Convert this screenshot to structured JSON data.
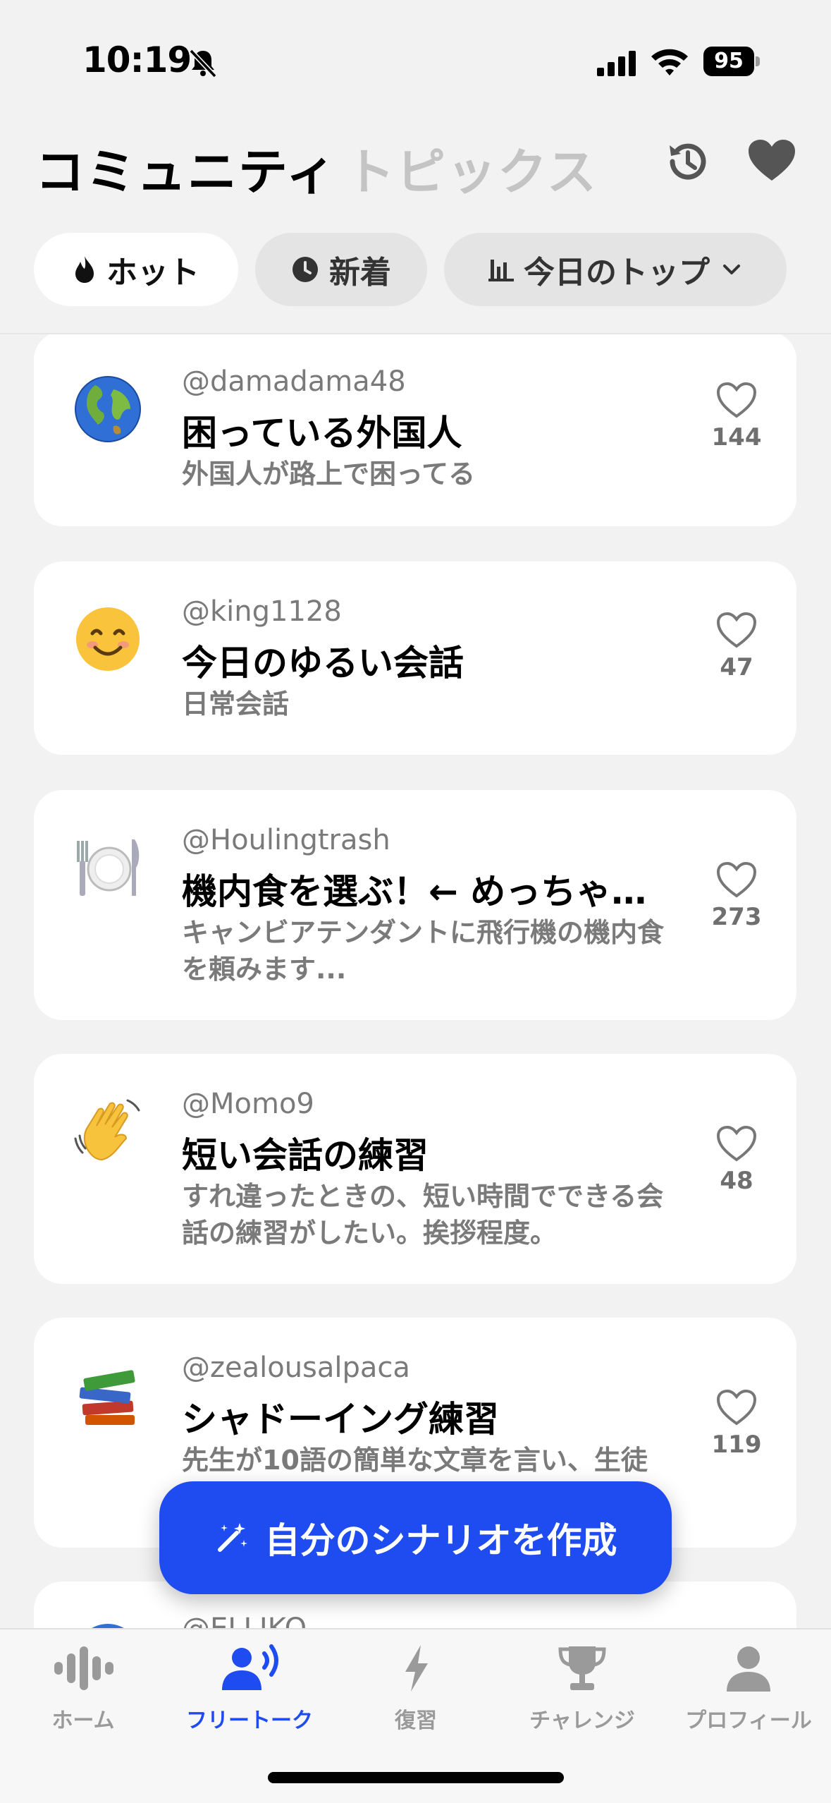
{
  "status": {
    "time": "10:19",
    "battery": "95"
  },
  "header": {
    "title_active": "コミュニティ",
    "title_inactive": "トピックス"
  },
  "filters": {
    "hot": "ホット",
    "new": "新着",
    "top": "今日のトップ"
  },
  "cards": [
    {
      "emoji": "globe",
      "user": "@damadama48",
      "title": "困っている外国人",
      "desc": "外国人が路上で困ってる",
      "likes": "144"
    },
    {
      "emoji": "smile",
      "user": "@king1128",
      "title": "今日のゆるい会話",
      "desc": "日常会話",
      "likes": "47"
    },
    {
      "emoji": "plate",
      "user": "@Houlingtrash",
      "title": "機内食を選ぶ！← めっちゃ…",
      "desc": "キャンビアテンダントに飛行機の機内食を頼みます...",
      "likes": "273"
    },
    {
      "emoji": "wave",
      "user": "@Momo9",
      "title": "短い会話の練習",
      "desc": "すれ違ったときの、短い時間でできる会話の練習がしたい。挨拶程度。",
      "likes": "48"
    },
    {
      "emoji": "books",
      "user": "@zealousalpaca",
      "title": "シャドーイング練習",
      "desc": "先生が10語の簡単な文章を言い、生徒",
      "likes": "119"
    },
    {
      "emoji": "globe",
      "user": "@ELLIKO",
      "title": "",
      "desc": "",
      "likes": ""
    }
  ],
  "fab": {
    "label": "自分のシナリオを作成"
  },
  "tabs": [
    {
      "label": "ホーム",
      "icon": "waveform-icon"
    },
    {
      "label": "フリートーク",
      "icon": "person-speaking-icon"
    },
    {
      "label": "復習",
      "icon": "bolt-icon"
    },
    {
      "label": "チャレンジ",
      "icon": "trophy-icon"
    },
    {
      "label": "プロフィール",
      "icon": "person-icon"
    }
  ],
  "colors": {
    "accent": "#1f4cf0",
    "background": "#f2f2f2"
  }
}
